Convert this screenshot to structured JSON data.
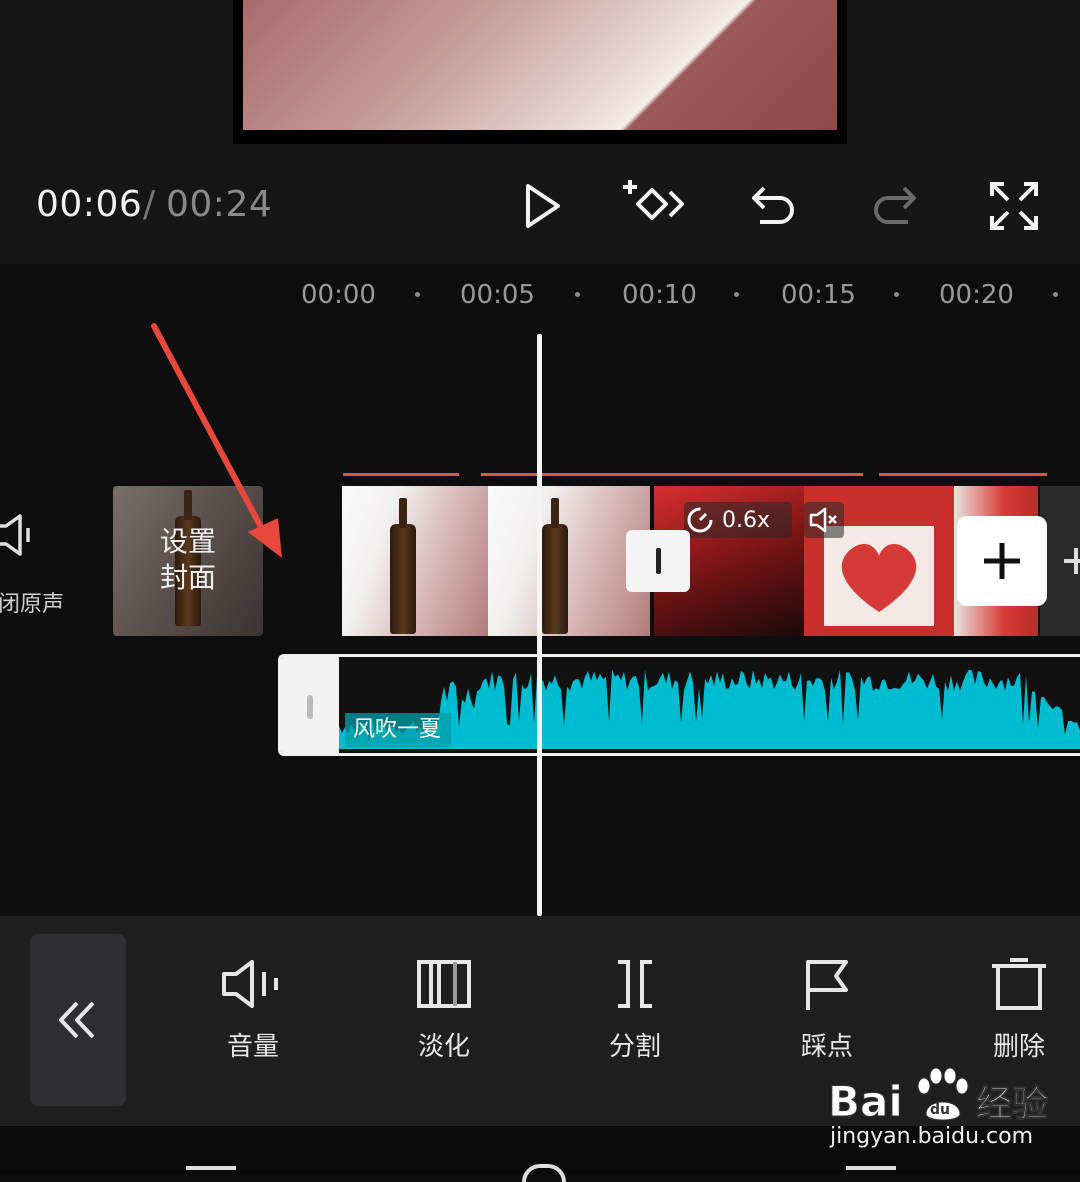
{
  "playback": {
    "current_time": "00:06",
    "separator": "/",
    "total_time": "00:24"
  },
  "ruler": {
    "ticks": [
      "00:00",
      "00:05",
      "00:10",
      "00:15",
      "00:20"
    ]
  },
  "timeline": {
    "mute_audio_label": "闭原声",
    "cover_label_line1": "设置",
    "cover_label_line2": "封面",
    "speed_label": "0.6x"
  },
  "audio": {
    "track_name": "风吹一夏"
  },
  "toolbar": {
    "tools": [
      {
        "label": "音量",
        "icon": "volume-icon"
      },
      {
        "label": "淡化",
        "icon": "fade-icon"
      },
      {
        "label": "分割",
        "icon": "split-icon"
      },
      {
        "label": "踩点",
        "icon": "beat-flag-icon"
      },
      {
        "label": "删除",
        "icon": "delete-icon"
      }
    ]
  },
  "watermark": {
    "logo_text": "Baidu经验",
    "url": "jingyan.baidu.com"
  },
  "colors": {
    "accent_red": "#d85a47",
    "waveform": "#00bcd0",
    "annotation_arrow": "#e8473e"
  }
}
